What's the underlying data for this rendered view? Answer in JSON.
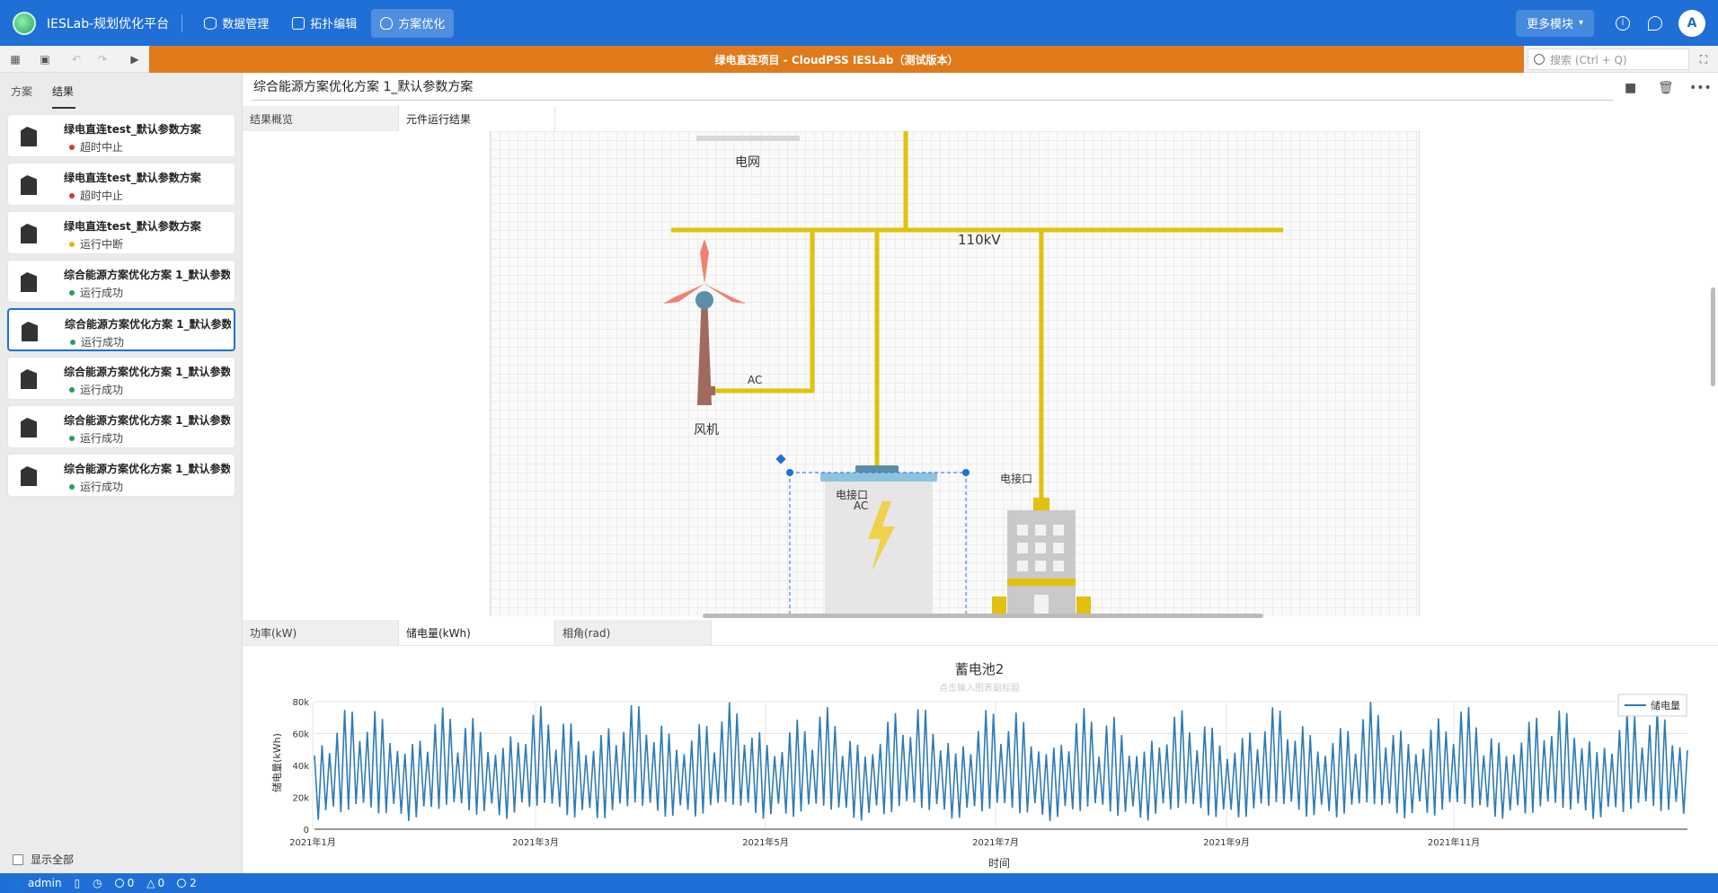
{
  "topbar": {
    "app_title": "IESLab-规划优化平台",
    "nav": [
      {
        "label": "数据管理",
        "icon": "database-icon"
      },
      {
        "label": "拓扑编辑",
        "icon": "topology-icon"
      },
      {
        "label": "方案优化",
        "icon": "lightbulb-icon"
      }
    ],
    "active_nav": "方案优化",
    "more_modules": "更多模块",
    "avatar_letter": "A",
    "color": "#1f6fd6"
  },
  "toolbar": {
    "project_title": "绿电直连项目 - CloudPSS IESLab（测试版本）",
    "search_placeholder": "搜索 (Ctrl + Q)",
    "banner_color": "#e07a1b"
  },
  "sidebar": {
    "tabs": [
      "方案",
      "结果"
    ],
    "active_tab": "结果",
    "items": [
      {
        "name": "绿电直连test_默认参数方案",
        "status": "超时中止",
        "status_color": "#d9363e"
      },
      {
        "name": "绿电直连test_默认参数方案",
        "status": "超时中止",
        "status_color": "#d9363e"
      },
      {
        "name": "绿电直连test_默认参数方案",
        "status": "运行中断",
        "status_color": "#e6b800"
      },
      {
        "name": "综合能源方案优化方案 1_默认参数方案",
        "status": "运行成功",
        "status_color": "#2e9d5a"
      },
      {
        "name": "综合能源方案优化方案 1_默认参数方案",
        "status": "运行成功",
        "status_color": "#2e9d5a"
      },
      {
        "name": "综合能源方案优化方案 1_默认参数方案",
        "status": "运行成功",
        "status_color": "#2e9d5a"
      },
      {
        "name": "综合能源方案优化方案 1_默认参数方案",
        "status": "运行成功",
        "status_color": "#2e9d5a"
      },
      {
        "name": "综合能源方案优化方案 1_默认参数方案",
        "status": "运行成功",
        "status_color": "#2e9d5a"
      }
    ],
    "selected_index": 4,
    "show_all_label": "显示全部"
  },
  "main": {
    "title": "综合能源方案优化方案 1_默认参数方案",
    "tabs": [
      "结果概览",
      "元件运行结果"
    ],
    "active_tab": "元件运行结果"
  },
  "diagram": {
    "grid_label": "电网",
    "bus_label": "110kV",
    "wind_label": "风机",
    "wind_ac_label": "AC",
    "battery_port_label": "电接口",
    "battery_ac_label": "AC",
    "load_port_label": "电接口",
    "bus_color": "#e2c10c"
  },
  "bottom_tabs": {
    "tabs": [
      "功率(kW)",
      "储电量(kWh)",
      "相角(rad)"
    ],
    "active_tab": "储电量(kWh)"
  },
  "chart_data": {
    "type": "line",
    "title": "蓄电池2",
    "subtitle": "点击输入图表副标题",
    "xlabel": "时间",
    "ylabel": "储电量(kWh)",
    "ylim": [
      0,
      80000
    ],
    "yticks": [
      "0",
      "20k",
      "40k",
      "60k",
      "80k"
    ],
    "xticks": [
      "2021年1月",
      "2021年3月",
      "2021年5月",
      "2021年7月",
      "2021年9月",
      "2021年11月"
    ],
    "legend_position": "top-right",
    "grid": true,
    "series": [
      {
        "name": "储电量",
        "color": "#2f7bb5",
        "note": "daily charge/discharge cycles over 2021; values read at monthly resolution (min/max of daily swing in kWh)",
        "monthly_min": [
          5000,
          6000,
          5000,
          6000,
          5000,
          6000,
          5000,
          5000,
          6000,
          6000,
          6000,
          6000
        ],
        "monthly_max": [
          80000,
          78000,
          80000,
          80000,
          78000,
          80000,
          78000,
          76000,
          78000,
          80000,
          78000,
          80000
        ]
      }
    ]
  },
  "statusbar": {
    "user": "admin",
    "errors": "0",
    "warnings": "0",
    "infos": "2"
  }
}
